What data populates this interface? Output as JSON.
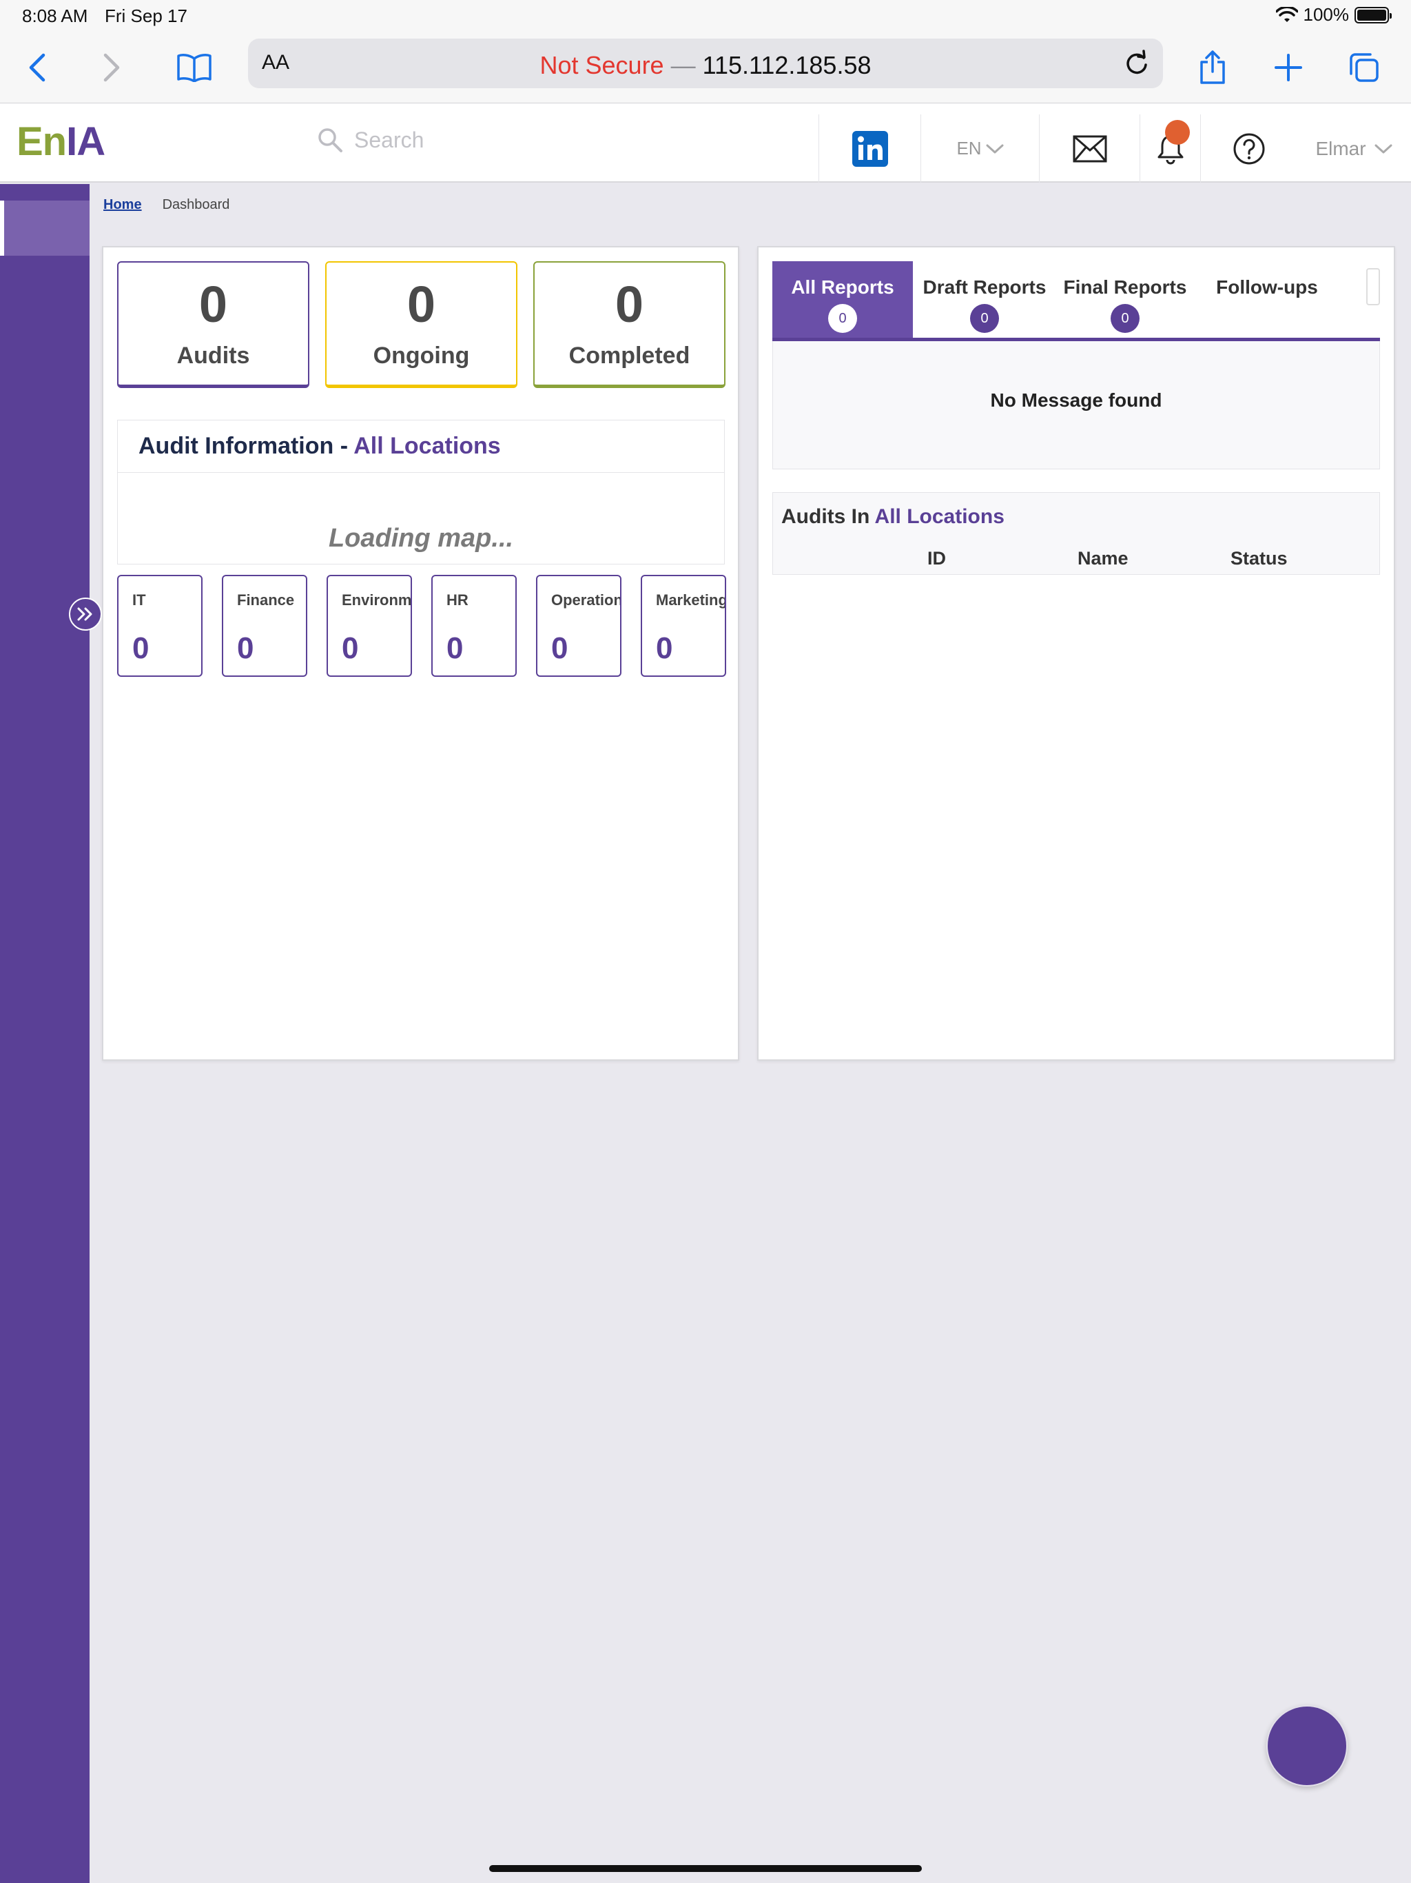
{
  "status_bar": {
    "time": "8:08 AM",
    "date": "Fri Sep 17",
    "battery": "100%"
  },
  "browser": {
    "aa_label": "AA",
    "not_secure": "Not Secure",
    "dash": " — ",
    "address": "115.112.185.58"
  },
  "header": {
    "logo_en": "En",
    "logo_ia": "IA",
    "search_placeholder": "Search",
    "language": "EN",
    "user_name": "Elmar"
  },
  "breadcrumb": {
    "home": "Home",
    "current": "Dashboard"
  },
  "stats": [
    {
      "value": "0",
      "label": "Audits"
    },
    {
      "value": "0",
      "label": "Ongoing"
    },
    {
      "value": "0",
      "label": "Completed"
    }
  ],
  "audit_info": {
    "title": "Audit Information - ",
    "location": "All Locations",
    "loading": "Loading map..."
  },
  "departments": [
    {
      "name": "IT",
      "value": "0"
    },
    {
      "name": "Finance",
      "value": "0"
    },
    {
      "name": "Environme",
      "value": "0"
    },
    {
      "name": "HR",
      "value": "0"
    },
    {
      "name": "Operations",
      "value": "0"
    },
    {
      "name": "Marketing",
      "value": "0"
    }
  ],
  "report_tabs": [
    {
      "label": "All Reports",
      "count": "0"
    },
    {
      "label": "Draft Reports",
      "count": "0"
    },
    {
      "label": "Final Reports",
      "count": "0"
    },
    {
      "label": "Follow-ups",
      "count": ""
    }
  ],
  "messages": {
    "empty": "No Message found"
  },
  "audits_table": {
    "title_prefix": "Audits In ",
    "location": "All Locations",
    "columns": [
      "ID",
      "Name",
      "Status"
    ]
  },
  "colors": {
    "brand_purple": "#5a4096",
    "brand_green": "#8aa23a",
    "ongoing_yellow": "#f2c500",
    "notif_orange": "#e06030",
    "not_secure_red": "#e3372f"
  }
}
